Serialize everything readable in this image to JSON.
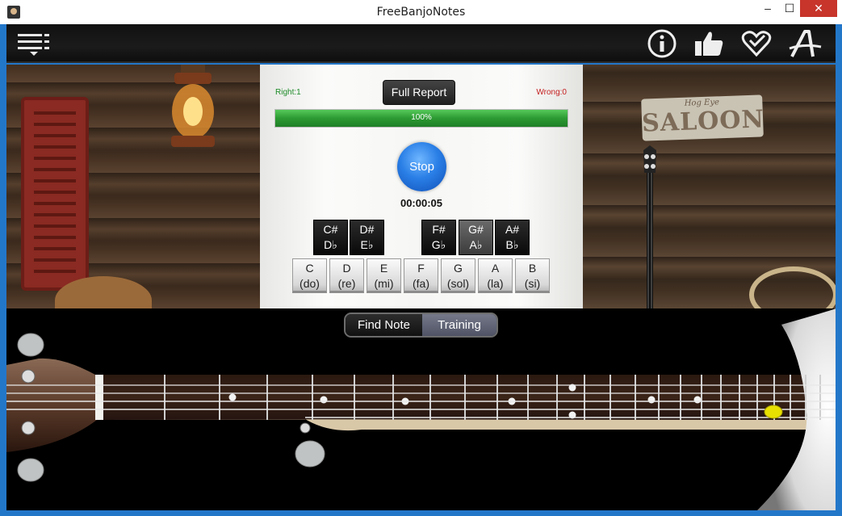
{
  "window": {
    "title": "FreeBanjoNotes",
    "minimize": "–",
    "maximize": "☐",
    "close": "✕"
  },
  "toolbar": {
    "menu_icon": "menu-icon",
    "info_icon": "info-icon",
    "like_icon": "thumbs-up-icon",
    "heart_icon": "heart-icon",
    "font_icon": "font-icon"
  },
  "scene": {
    "sign_small": "Hog Eye",
    "sign_text": "SALOON"
  },
  "quiz": {
    "right_label": "Right:1",
    "wrong_label": "Wrong:0",
    "report_label": "Full Report",
    "progress_text": "100%",
    "progress_value": 1.0,
    "stop_label": "Stop",
    "timer": "00:00:05"
  },
  "keys": {
    "sharps": [
      {
        "top": "C#",
        "bottom": "D♭"
      },
      {
        "top": "D#",
        "bottom": "E♭"
      },
      {
        "top": "F#",
        "bottom": "G♭"
      },
      {
        "top": "G#",
        "bottom": "A♭"
      },
      {
        "top": "A#",
        "bottom": "B♭"
      }
    ],
    "naturals": [
      {
        "top": "C",
        "bottom": "(do)"
      },
      {
        "top": "D",
        "bottom": "(re)"
      },
      {
        "top": "E",
        "bottom": "(mi)"
      },
      {
        "top": "F",
        "bottom": "(fa)"
      },
      {
        "top": "G",
        "bottom": "(sol)"
      },
      {
        "top": "A",
        "bottom": "(la)"
      },
      {
        "top": "B",
        "bottom": "(si)"
      }
    ]
  },
  "tabs": {
    "find_note": "Find Note",
    "training": "Training"
  },
  "colors": {
    "accent": "#2377c9",
    "progress": "#2c9a32",
    "stop": "#2a7fe6",
    "marker": "#e8e000"
  }
}
